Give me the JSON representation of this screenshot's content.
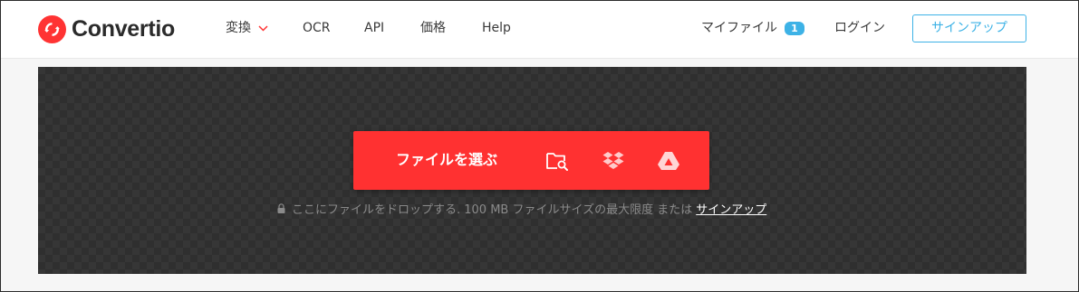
{
  "brand": {
    "name": "Convertio",
    "accent": "#ff3333",
    "link_color": "#3db2e6"
  },
  "nav": {
    "convert": "変換",
    "ocr": "OCR",
    "api": "API",
    "price": "価格",
    "help": "Help"
  },
  "account": {
    "my_files": "マイファイル",
    "my_files_count": "1",
    "login": "ログイン",
    "signup": "サインアップ"
  },
  "upload": {
    "choose_files": "ファイルを選ぶ",
    "sources": [
      "folder-search-icon",
      "dropbox-icon",
      "google-drive-icon"
    ],
    "hint_text": "ここにファイルをドロップする. 100 MB ファイルサイズの最大限度 または",
    "hint_link": "サインアップ"
  }
}
